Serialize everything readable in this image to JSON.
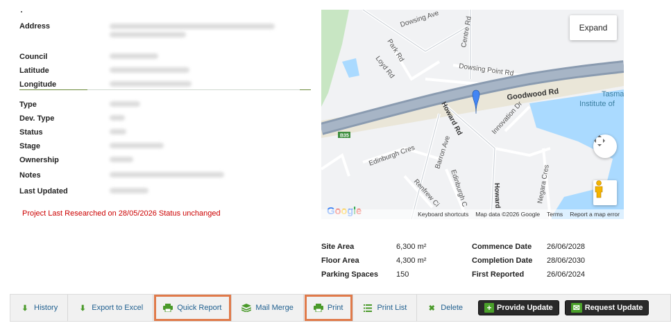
{
  "details": {
    "address_label": "Address",
    "council_label": "Council",
    "latitude_label": "Latitude",
    "longitude_label": "Longitude",
    "type_label": "Type",
    "dev_type_label": "Dev. Type",
    "status_label": "Status",
    "stage_label": "Stage",
    "ownership_label": "Ownership",
    "notes_label": "Notes",
    "last_updated_label": "Last Updated"
  },
  "researched_note": "Project Last Researched on 28/05/2026 Status unchanged",
  "map": {
    "expand_label": "Expand",
    "streets": {
      "dowsing_ave": "Dowsing Ave",
      "park_rd": "Park Rd",
      "centre_rd": "Centre Rd",
      "loyd_rd": "Loyd Rd",
      "dowsing_point_rd": "Dowsing Point Rd",
      "goodwood_rd": "Goodwood Rd",
      "howard_rd": "Howard Rd",
      "innovation_dr": "Innovation Dr",
      "edinburgh_cres": "Edinburgh Cres",
      "barron_ave": "Barron Ave",
      "renfrew_ci": "Renfrew Ci",
      "edinburgh_c": "Edinburgh C",
      "howard": "Howard",
      "negara_cres": "Negara Cres",
      "b35": "B35",
      "tasma": "Tasma",
      "institute_of": "Institute of"
    },
    "google": "Google",
    "footer": {
      "shortcuts": "Keyboard shortcuts",
      "map_data": "Map data ©2026 Google",
      "terms": "Terms",
      "report": "Report a map error"
    },
    "colors": {
      "road": "#9aa9b9",
      "water": "#aadaff",
      "park": "#c8e6c3",
      "land": "#f1f2f4",
      "pin": "#4285f4"
    }
  },
  "stats": {
    "site_area_label": "Site Area",
    "site_area_value": "6,300 m²",
    "commence_label": "Commence Date",
    "commence_value": "26/06/2028",
    "floor_area_label": "Floor Area",
    "floor_area_value": "4,300 m²",
    "completion_label": "Completion Date",
    "completion_value": "28/06/2030",
    "parking_label": "Parking Spaces",
    "parking_value": "150",
    "first_reported_label": "First Reported",
    "first_reported_value": "26/06/2024"
  },
  "toolbar": {
    "history": "History",
    "export_excel": "Export to Excel",
    "quick_report": "Quick Report",
    "mail_merge": "Mail Merge",
    "print": "Print",
    "print_list": "Print List",
    "delete": "Delete",
    "provide_update": "Provide Update",
    "request_update": "Request Update"
  },
  "colors": {
    "highlight": "#e07a4a",
    "link": "#1f5f8f",
    "icon_green": "#4a9a2a",
    "note_red": "#cc0000"
  }
}
